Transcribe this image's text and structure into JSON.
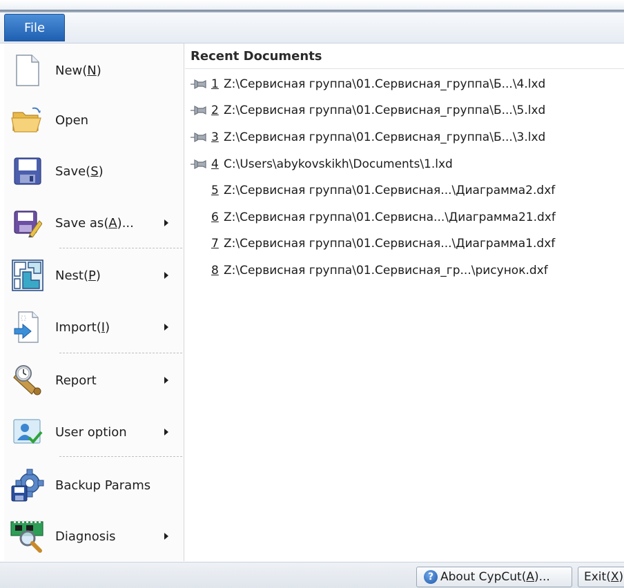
{
  "tabs": {
    "file": "File"
  },
  "menu": [
    {
      "id": "new",
      "pre": "New(",
      "key": "N",
      "post": ")",
      "submenu": false,
      "icon": "new-document-icon"
    },
    {
      "id": "open",
      "pre": "Open",
      "key": "",
      "post": "",
      "submenu": false,
      "icon": "open-folder-icon"
    },
    {
      "id": "save",
      "pre": "Save(",
      "key": "S",
      "post": ")",
      "submenu": false,
      "icon": "save-floppy-icon"
    },
    {
      "id": "save-as",
      "pre": "Save as(",
      "key": "A",
      "post": ")...",
      "submenu": true,
      "icon": "save-as-icon"
    },
    {
      "id": "nest",
      "pre": "Nest(",
      "key": "P",
      "post": ")",
      "submenu": true,
      "icon": "nest-icon"
    },
    {
      "id": "import",
      "pre": "Import(",
      "key": "I",
      "post": ")",
      "submenu": true,
      "icon": "import-icon"
    },
    {
      "id": "report",
      "pre": "Report",
      "key": "",
      "post": "",
      "submenu": true,
      "icon": "report-scroll-icon"
    },
    {
      "id": "user-option",
      "pre": "User option",
      "key": "",
      "post": "",
      "submenu": true,
      "icon": "user-option-icon"
    },
    {
      "id": "backup-params",
      "pre": "Backup Params",
      "key": "",
      "post": "",
      "submenu": false,
      "icon": "backup-gear-icon"
    },
    {
      "id": "diagnosis",
      "pre": "Diagnosis",
      "key": "",
      "post": "",
      "submenu": true,
      "icon": "diagnosis-icon"
    }
  ],
  "recent": {
    "title": "Recent Documents",
    "items": [
      {
        "num": "1",
        "path": "Z:\\Сервисная группа\\01.Сервисная_группа\\Б...\\4.lxd",
        "pinned": true
      },
      {
        "num": "2",
        "path": "Z:\\Сервисная группа\\01.Сервисная_группа\\Б...\\5.lxd",
        "pinned": true
      },
      {
        "num": "3",
        "path": "Z:\\Сервисная группа\\01.Сервисная_группа\\Б...\\3.lxd",
        "pinned": true
      },
      {
        "num": "4",
        "path": "C:\\Users\\abykovskikh\\Documents\\1.lxd",
        "pinned": true
      },
      {
        "num": "5",
        "path": "Z:\\Сервисная группа\\01.Сервисная...\\Диаграмма2.dxf",
        "pinned": false
      },
      {
        "num": "6",
        "path": "Z:\\Сервисная группа\\01.Сервисна...\\Диаграмма21.dxf",
        "pinned": false
      },
      {
        "num": "7",
        "path": "Z:\\Сервисная группа\\01.Сервисная...\\Диаграмма1.dxf",
        "pinned": false
      },
      {
        "num": "8",
        "path": "Z:\\Сервисная группа\\01.Сервисная_гр...\\рисунок.dxf",
        "pinned": false
      }
    ]
  },
  "bottom": {
    "about": {
      "pre": "About CypCut(",
      "key": "A",
      "post": ")..."
    },
    "exit": {
      "pre": "Exit(",
      "key": "X",
      "post": ")"
    }
  }
}
